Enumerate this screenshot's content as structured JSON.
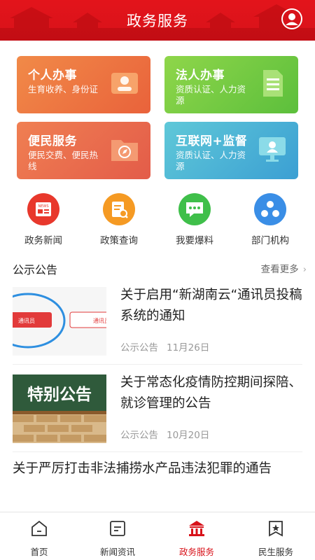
{
  "header": {
    "title": "政务服务",
    "avatar_icon": "user-avatar-icon"
  },
  "cards": [
    {
      "title": "个人办事",
      "subtitle": "生育收养、身份证",
      "icon": "id-card-icon"
    },
    {
      "title": "法人办事",
      "subtitle": "资质认证、人力资源",
      "icon": "document-icon"
    },
    {
      "title": "便民服务",
      "subtitle": "便民交费、便民热线",
      "icon": "compass-folder-icon"
    },
    {
      "title": "互联网+监督",
      "subtitle": "资质认证、人力资源",
      "icon": "monitor-icon"
    }
  ],
  "quick_links": [
    {
      "label": "政务新闻",
      "icon": "news-icon",
      "color": "#e8382c"
    },
    {
      "label": "政策查询",
      "icon": "policy-search-icon",
      "color": "#f59a23"
    },
    {
      "label": "我要爆料",
      "icon": "chat-bubble-icon",
      "color": "#3fbf4a"
    },
    {
      "label": "部门机构",
      "icon": "organization-icon",
      "color": "#3a8ee6"
    }
  ],
  "section": {
    "title": "公示公告",
    "more_label": "查看更多"
  },
  "articles": [
    {
      "title": "关于启用“新湖南云“通讯员投稿系统的通知",
      "category": "公示公告",
      "date": "11月26日",
      "thumb_text_a": "通讯员",
      "thumb_text_b": "通讯员"
    },
    {
      "title": "关于常态化疫情防控期间探陪、就诊管理的公告",
      "category": "公示公告",
      "date": "10月20日",
      "thumb_text": "特别公告"
    },
    {
      "title": "关于严厉打击非法捕捞水产品违法犯罪的通告"
    }
  ],
  "tabbar": [
    {
      "label": "首页",
      "icon": "home-icon",
      "active": false
    },
    {
      "label": "新闻资讯",
      "icon": "news-list-icon",
      "active": false
    },
    {
      "label": "政务服务",
      "icon": "government-building-icon",
      "active": true
    },
    {
      "label": "民生服务",
      "icon": "star-bookmark-icon",
      "active": false
    }
  ],
  "colors": {
    "brand": "#d8121a",
    "active_tab": "#d8121a"
  }
}
